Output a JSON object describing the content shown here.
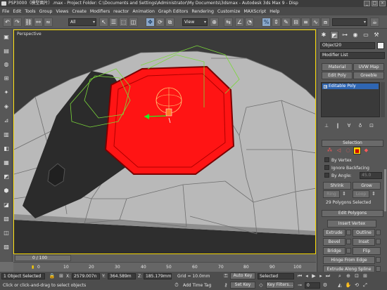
{
  "window": {
    "title": "PSP3000（模型面片）.max  - Project Folder: C:\\Documents and Settings\\Administrator\\My Documents\\3dsmax   - Autodesk 3ds Max 9   - Disp",
    "min_label": "_",
    "max_label": "□",
    "close_label": "×"
  },
  "menu": [
    "File",
    "Edit",
    "Tools",
    "Group",
    "Views",
    "Create",
    "Modifiers",
    "reactor",
    "Animation",
    "Graph Editors",
    "Rendering",
    "Customize",
    "MAXScript",
    "Help"
  ],
  "toolbar": {
    "selection_filter": "All",
    "coord_system": "View",
    "named_selection": ""
  },
  "viewport": {
    "label": "Perspective"
  },
  "command_panel": {
    "object_name": "Object20",
    "modifier_list": "Modifier List",
    "buttons": [
      "Material",
      "UVW Map",
      "Edit Poly",
      "Greeble"
    ],
    "stack_item": "Editable Poly",
    "selection_rollout": "Selection",
    "by_vertex": "By Vertex",
    "ignore_backfacing": "Ignore Backfacing",
    "by_angle": "By Angle:",
    "by_angle_value": "45.0",
    "shrink": "Shrink",
    "grow": "Grow",
    "ring": "Ring",
    "loop": "Loop",
    "selected_info": "29 Polygons Selected",
    "edit_polygons_rollout": "Edit Polygons",
    "insert_vertex": "Insert Vertex",
    "extrude": "Extrude",
    "outline": "Outline",
    "bevel": "Bevel",
    "inset": "Inset",
    "bridge": "Bridge",
    "flip": "Flip",
    "hinge_from_edge": "Hinge From Edge",
    "extrude_along_spline": "Extrude Along Spline"
  },
  "timeline": {
    "frame_display": "0 / 100",
    "ticks": [
      "0",
      "10",
      "20",
      "30",
      "40",
      "50",
      "60",
      "70",
      "80",
      "90",
      "100"
    ]
  },
  "status": {
    "selection_info": "1 Object Selected",
    "prompt": "Click or click-and-drag to select objects",
    "x_label": "X:",
    "x_value": "2579.007n",
    "y_label": "Y:",
    "y_value": "364.589m",
    "z_label": "Z:",
    "z_value": "185.179mm",
    "grid": "Grid = 10.0mm",
    "add_time_tag": "Add Time Tag",
    "auto_key": "Auto Key",
    "set_key": "Set Key",
    "key_filter_value": "Selected",
    "key_filters": "Key Filters...",
    "frame_value": "0"
  },
  "colors": {
    "selection_red": "#ff1a1a",
    "viewport_border": "#f2d400",
    "grid_green": "#7bd83a"
  }
}
